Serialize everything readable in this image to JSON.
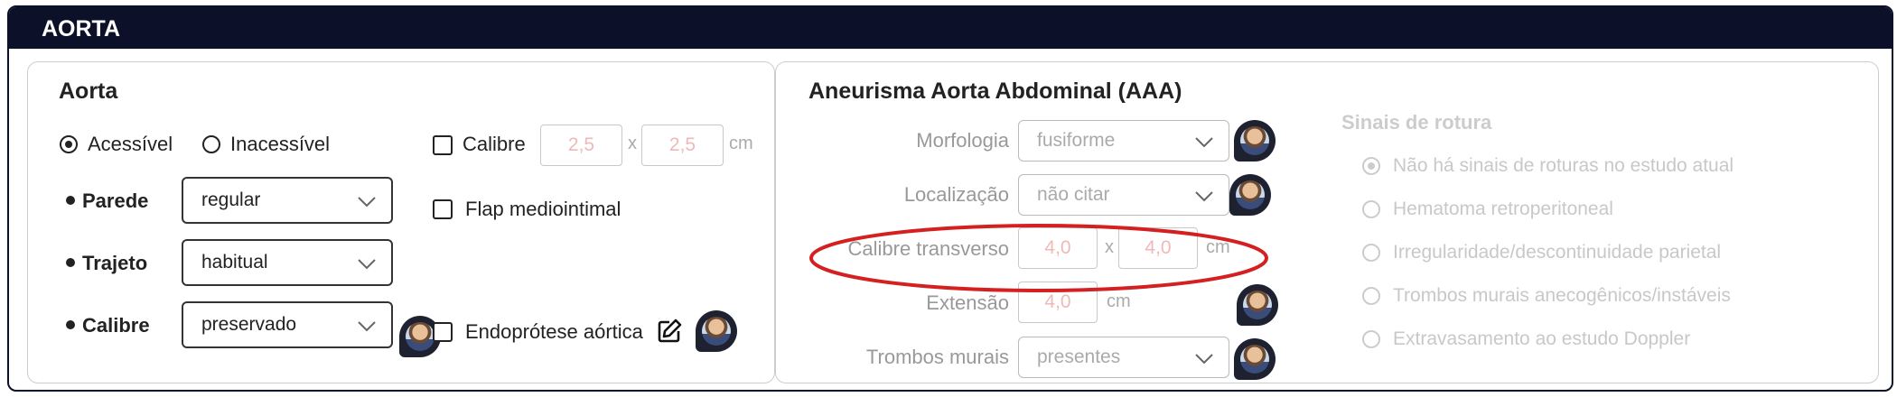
{
  "section_title": "AORTA",
  "aorta": {
    "title": "Aorta",
    "access_options": [
      "Acessível",
      "Inacessível"
    ],
    "access_selected": "Acessível",
    "parede": {
      "label": "Parede",
      "value": "regular"
    },
    "trajeto": {
      "label": "Trajeto",
      "value": "habitual"
    },
    "calibre": {
      "label": "Calibre",
      "value": "preservado"
    },
    "calibre_check": {
      "label": "Calibre",
      "value1": "2,5",
      "separator": "x",
      "value2": "2,5",
      "unit": "cm"
    },
    "flap": {
      "label": "Flap mediointimal"
    },
    "endoprotese": {
      "label": "Endoprótese aórtica"
    }
  },
  "aaa": {
    "title": "Aneurisma Aorta Abdominal (AAA)",
    "morfologia": {
      "label": "Morfologia",
      "value": "fusiforme"
    },
    "localizacao": {
      "label": "Localização",
      "value": "não citar"
    },
    "calibre_transverso": {
      "label": "Calibre transverso",
      "value1": "4,0",
      "separator": "x",
      "value2": "4,0",
      "unit": "cm"
    },
    "extensao": {
      "label": "Extensão",
      "value": "4,0",
      "unit": "cm"
    },
    "trombos": {
      "label": "Trombos murais",
      "value": "presentes"
    },
    "rotura": {
      "title": "Sinais de rotura",
      "options": [
        "Não há sinais de roturas no estudo atual",
        "Hematoma retroperitoneal",
        "Irregularidade/descontinuidade parietal",
        "Trombos murais anecogênicos/instáveis",
        "Extravasamento ao estudo Doppler"
      ],
      "selected_index": 0
    }
  },
  "colors": {
    "header_bg": "#0c1028",
    "annotation_ellipse": "#d42020",
    "disabled_value": "#f0b8b8"
  },
  "icons": [
    "chevron-down-icon",
    "edit-icon",
    "avatar-icon"
  ]
}
